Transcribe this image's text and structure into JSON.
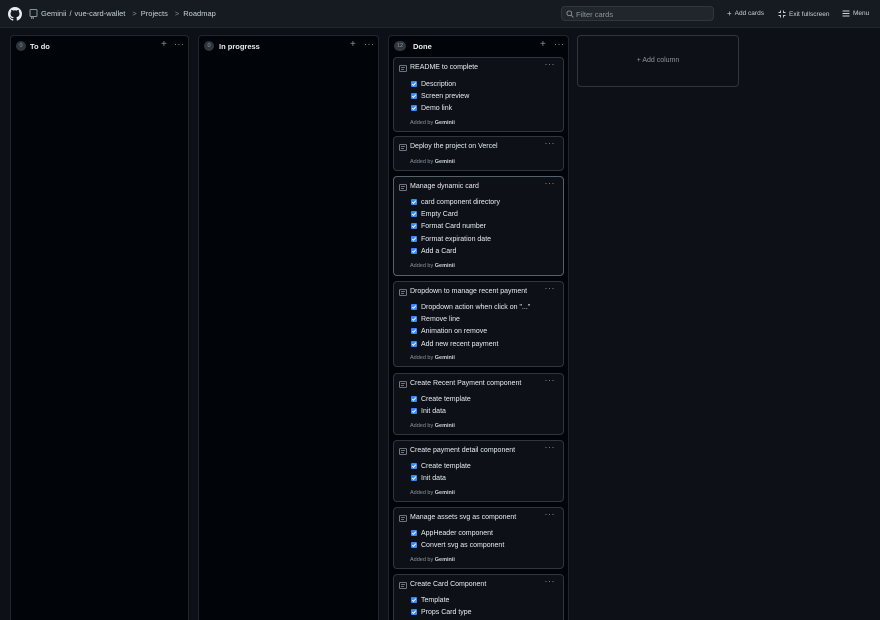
{
  "topbar": {
    "crumbs": [
      "Geminii",
      "/",
      "vue-card-wallet",
      ">",
      "Projects",
      ">",
      "Roadmap"
    ],
    "filter_placeholder": "Filter cards",
    "add_cards": "Add cards",
    "exit_fullscreen": "Exit fullscreen",
    "menu": "Menu"
  },
  "columns": [
    {
      "count": "0",
      "title": "To do"
    },
    {
      "count": "0",
      "title": "In progress"
    },
    {
      "count": "12",
      "title": "Done"
    }
  ],
  "add_column": "+ Add column",
  "added_by_prefix": "Added by",
  "added_by_user": "Geminii",
  "cards": [
    {
      "title": "README to complete",
      "items": [
        "Description",
        "Screen preview",
        "Demo link"
      ]
    },
    {
      "title": "Deploy the project on Vercel",
      "items": []
    },
    {
      "title": "Manage dynamic card",
      "items": [
        "card component directory",
        "Empty Card",
        "Format Card number",
        "Format expiration date",
        "Add a Card"
      ]
    },
    {
      "title": "Dropdown to manage recent payment",
      "items": [
        "Dropdown action when click on \"...\"",
        "Remove line",
        "Animation on remove",
        "Add new recent payment"
      ]
    },
    {
      "title": "Create Recent Payment component",
      "items": [
        "Create template",
        "Init data"
      ]
    },
    {
      "title": "Create payment detail component",
      "items": [
        "Create template",
        "Init data"
      ]
    },
    {
      "title": "Manage assets svg as component",
      "items": [
        "AppHeader component",
        "Convert svg as component"
      ]
    },
    {
      "title": "Create Card Component",
      "items": [
        "Template",
        "Props Card type"
      ]
    }
  ],
  "colors": {
    "background": "#0d1117",
    "checkbox": "#388bfd",
    "border": "#30363d"
  }
}
